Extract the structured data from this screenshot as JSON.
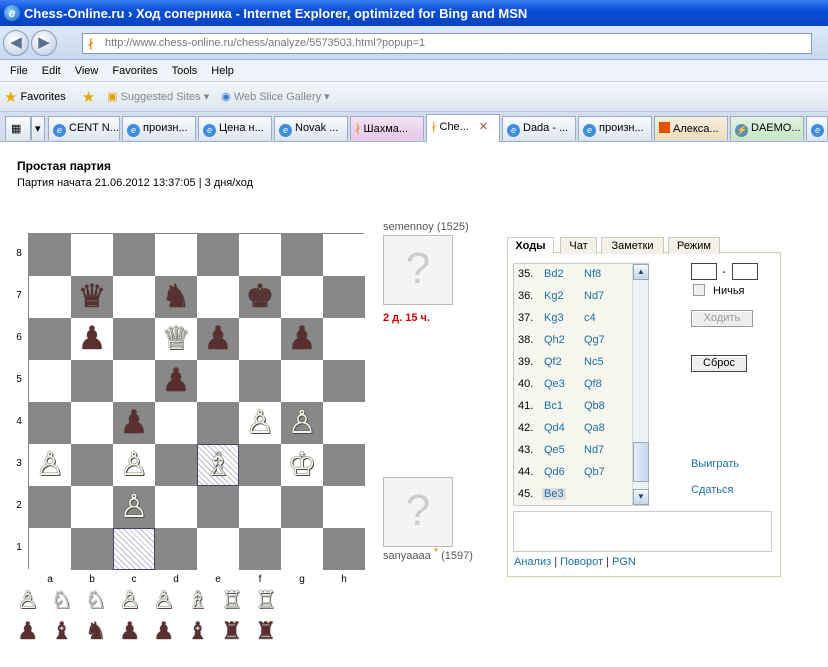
{
  "window": {
    "title": "Chess-Online.ru › Ход соперника - Internet Explorer, optimized for Bing and MSN"
  },
  "address": {
    "url": "http://www.chess-online.ru/chess/analyze/5573503.html?popup=1"
  },
  "menu": [
    "File",
    "Edit",
    "View",
    "Favorites",
    "Tools",
    "Help"
  ],
  "favorites": {
    "label": "Favorites",
    "suggested": "Suggested Sites ▾",
    "webslice": "Web Slice Gallery ▾"
  },
  "tabs": [
    "CENT N...",
    "произн...",
    "Цена н...",
    "Novak ...",
    "Шахма...",
    "Che...",
    "Dada - ...",
    "произн...",
    "Алекса...",
    "DAEMO..."
  ],
  "game": {
    "title": "Простая партия",
    "started": "Партия начата 21.06.2012 13:37:05 | 3 дня/ход"
  },
  "board": {
    "ranks": [
      "8",
      "7",
      "6",
      "5",
      "4",
      "3",
      "2",
      "1"
    ],
    "files": [
      "a",
      "b",
      "c",
      "d",
      "e",
      "f",
      "g",
      "h"
    ],
    "pieces": [
      {
        "sq": "b7",
        "p": "♛",
        "c": "b"
      },
      {
        "sq": "d7",
        "p": "♞",
        "c": "b"
      },
      {
        "sq": "f7",
        "p": "♚",
        "c": "b"
      },
      {
        "sq": "b6",
        "p": "♟",
        "c": "b"
      },
      {
        "sq": "d6",
        "p": "♕",
        "c": "w"
      },
      {
        "sq": "e6",
        "p": "♟",
        "c": "b"
      },
      {
        "sq": "g6",
        "p": "♟",
        "c": "b"
      },
      {
        "sq": "d5",
        "p": "♟",
        "c": "b"
      },
      {
        "sq": "c4",
        "p": "♟",
        "c": "b"
      },
      {
        "sq": "f4",
        "p": "♙",
        "c": "w"
      },
      {
        "sq": "g4",
        "p": "♙",
        "c": "w"
      },
      {
        "sq": "a3",
        "p": "♙",
        "c": "w"
      },
      {
        "sq": "c3",
        "p": "♙",
        "c": "w"
      },
      {
        "sq": "e3",
        "p": "♗",
        "c": "w"
      },
      {
        "sq": "g3",
        "p": "♔",
        "c": "w"
      },
      {
        "sq": "c2",
        "p": "♙",
        "c": "w"
      }
    ],
    "highlight": [
      "e3",
      "c1"
    ]
  },
  "captured": {
    "white": [
      "♙",
      "♘",
      "♘",
      "♙",
      "♙",
      "♗",
      "♖",
      "♖"
    ],
    "black": [
      "♟",
      "♝",
      "♞",
      "♟",
      "♟",
      "♝",
      "♜",
      "♜"
    ]
  },
  "players": {
    "top": {
      "name": "semennoy",
      "rating": "(1525)",
      "time": "2 д. 15 ч."
    },
    "bottom": {
      "name": "sanyaaaa",
      "rating": "(1597)",
      "star": "*"
    }
  },
  "panel": {
    "tabs": [
      "Ходы",
      "Чат",
      "Заметки",
      "Режим"
    ],
    "moves": [
      {
        "n": "35.",
        "w": "Bd2",
        "b": "Nf8"
      },
      {
        "n": "36.",
        "w": "Kg2",
        "b": "Nd7"
      },
      {
        "n": "37.",
        "w": "Kg3",
        "b": "c4"
      },
      {
        "n": "38.",
        "w": "Qh2",
        "b": "Qg7"
      },
      {
        "n": "39.",
        "w": "Qf2",
        "b": "Nc5"
      },
      {
        "n": "40.",
        "w": "Qe3",
        "b": "Qf8"
      },
      {
        "n": "41.",
        "w": "Bc1",
        "b": "Qb8"
      },
      {
        "n": "42.",
        "w": "Qd4",
        "b": "Qa8"
      },
      {
        "n": "43.",
        "w": "Qe5",
        "b": "Nd7"
      },
      {
        "n": "44.",
        "w": "Qd6",
        "b": "Qb7"
      },
      {
        "n": "45.",
        "w": "Be3",
        "b": ""
      }
    ],
    "score_sep": "-",
    "draw": "Ничья",
    "move_btn": "Ходить",
    "reset_btn": "Сброс",
    "win": "Выиграть",
    "resign": "Сдаться",
    "links": {
      "analysis": "Анализ",
      "rotate": "Поворот",
      "pgn": "PGN",
      "sep": "|"
    }
  }
}
